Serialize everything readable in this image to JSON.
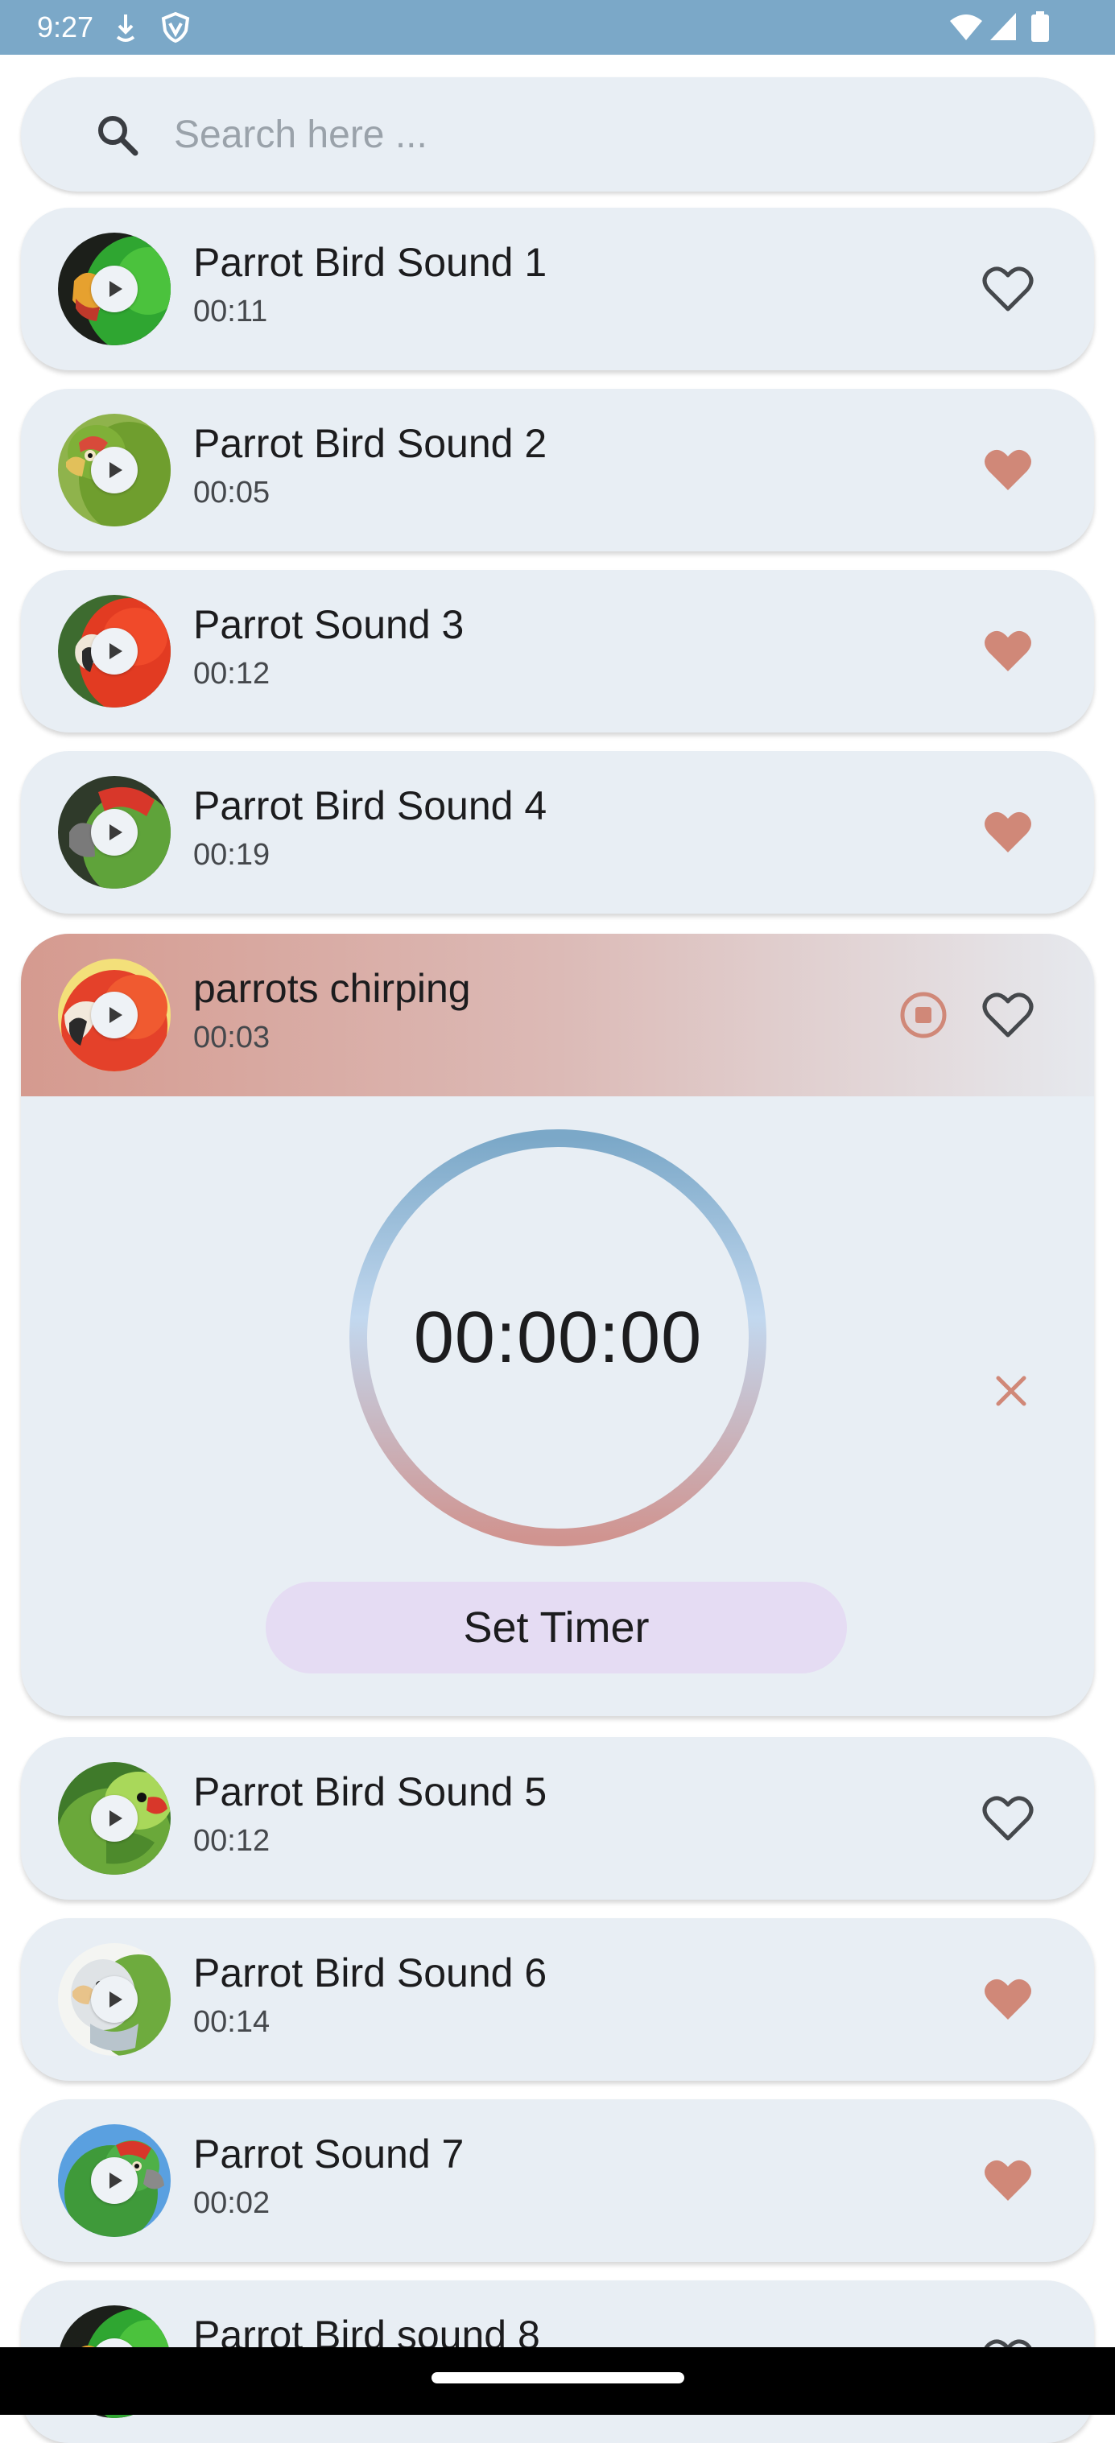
{
  "status_bar": {
    "time": "9:27",
    "icons": [
      "data-saver-icon",
      "vpn-shield-icon",
      "wifi-icon",
      "signal-icon",
      "battery-icon"
    ]
  },
  "search": {
    "placeholder": "Search here ...",
    "value": ""
  },
  "colors": {
    "accent_heart": "#d08878",
    "status_bar": "#7ba8c8",
    "card_background": "#e8eef4",
    "set_timer_button": "#e5dcf3"
  },
  "sounds": [
    {
      "title": "Parrot Bird Sound 1",
      "duration": "00:11",
      "favorite": false,
      "image": "green-eclectus-parrot"
    },
    {
      "title": "Parrot Bird Sound 2",
      "duration": "00:05",
      "favorite": true,
      "image": "green-amazon-parrot"
    },
    {
      "title": "Parrot Sound 3",
      "duration": "00:12",
      "favorite": true,
      "image": "scarlet-macaw"
    },
    {
      "title": "Parrot Bird Sound 4",
      "duration": "00:19",
      "favorite": true,
      "image": "red-crowned-amazon"
    },
    {
      "title": "parrots chirping",
      "duration": "00:03",
      "favorite": false,
      "playing": true,
      "image": "scarlet-macaw-closeup"
    },
    {
      "title": "Parrot Bird Sound 5",
      "duration": "00:12",
      "favorite": false,
      "image": "rose-ringed-parakeet"
    },
    {
      "title": "Parrot Bird Sound 6",
      "duration": "00:14",
      "favorite": true,
      "image": "quaker-parrot"
    },
    {
      "title": "Parrot Sound 7",
      "duration": "00:02",
      "favorite": true,
      "image": "amazon-parrot-blue-sky"
    },
    {
      "title": "Parrot Bird sound 8",
      "duration": "",
      "favorite": false,
      "image": "green-eclectus-parrot"
    }
  ],
  "timer": {
    "display": "00:00:00",
    "set_button_label": "Set Timer"
  }
}
